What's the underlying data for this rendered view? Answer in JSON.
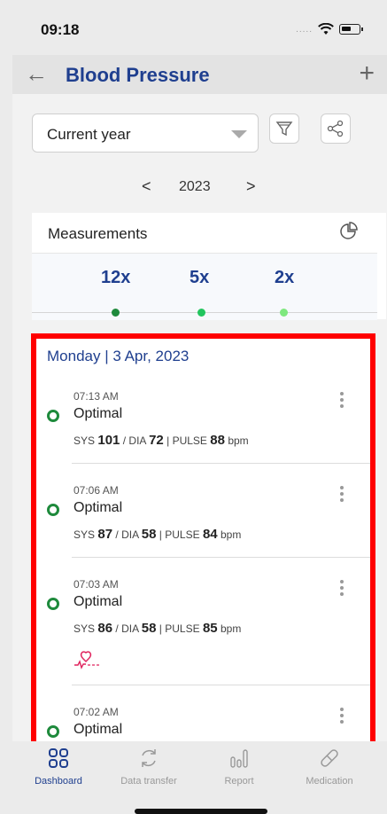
{
  "status_bar": {
    "time": "09:18",
    "signal": "....."
  },
  "nav": {
    "title": "Blood Pressure",
    "back_icon": "arrow-left-icon",
    "add_icon": "plus-icon"
  },
  "filter": {
    "period_value": "Current year"
  },
  "year_nav": {
    "prev": "<",
    "year": "2023",
    "next": ">"
  },
  "measurements": {
    "title": "Measurements",
    "counts": [
      {
        "label": "12x",
        "color": "#1e8a3c"
      },
      {
        "label": "5x",
        "color": "#22c55e"
      },
      {
        "label": "2x",
        "color": "#7ee87e"
      }
    ]
  },
  "day": {
    "header": "Monday | 3 Apr, 2023"
  },
  "entries": [
    {
      "time": "07:13 AM",
      "status": "Optimal",
      "sys_label": "SYS",
      "sys": "101",
      "dia_label": "DIA",
      "dia": "72",
      "pulse_label": "PULSE",
      "pulse": "88",
      "unit": "bpm"
    },
    {
      "time": "07:06 AM",
      "status": "Optimal",
      "sys_label": "SYS",
      "sys": "87",
      "dia_label": "DIA",
      "dia": "58",
      "pulse_label": "PULSE",
      "pulse": "84",
      "unit": "bpm"
    },
    {
      "time": "07:03 AM",
      "status": "Optimal",
      "sys_label": "SYS",
      "sys": "86",
      "dia_label": "DIA",
      "dia": "58",
      "pulse_label": "PULSE",
      "pulse": "85",
      "unit": "bpm"
    },
    {
      "time": "07:02 AM",
      "status": "Optimal"
    }
  ],
  "tabs": [
    {
      "label": "Dashboard",
      "icon": "dashboard-icon",
      "active": true
    },
    {
      "label": "Data transfer",
      "icon": "sync-icon",
      "active": false
    },
    {
      "label": "Report",
      "icon": "report-icon",
      "active": false
    },
    {
      "label": "Medication",
      "icon": "pill-icon",
      "active": false
    }
  ],
  "colors": {
    "accent": "#1f3f8f",
    "optimal": "#1e8a3c",
    "highlight": "#ff0000",
    "heart": "#e0245e"
  }
}
